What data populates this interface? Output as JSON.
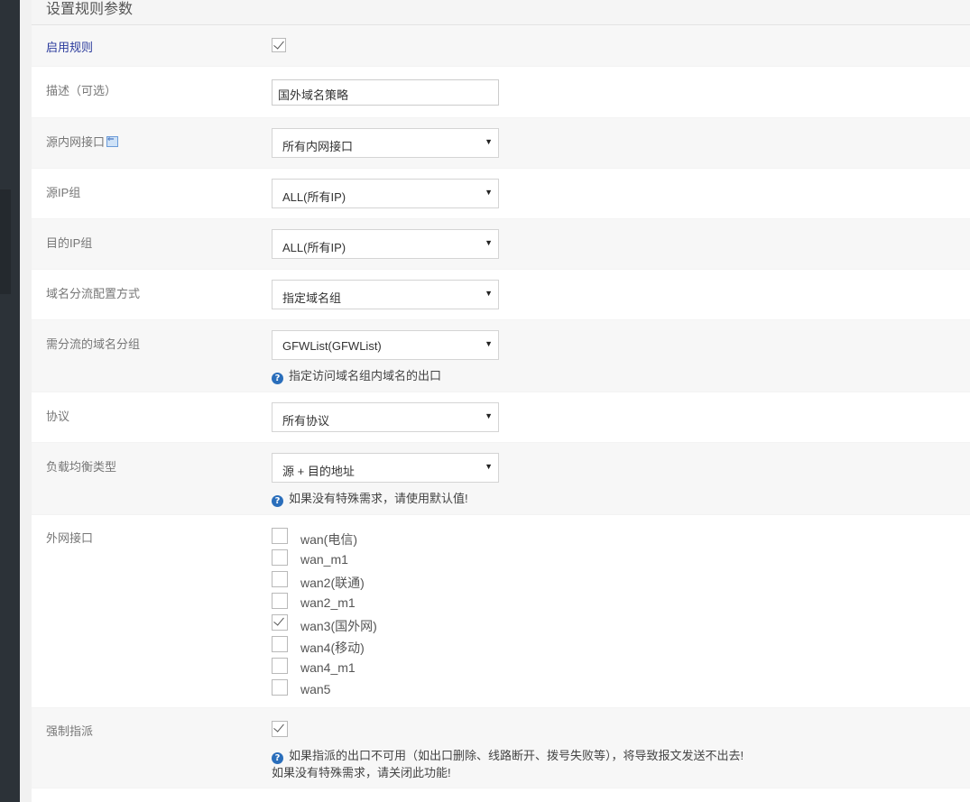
{
  "section_title": "设置规则参数",
  "rows": {
    "enable": {
      "label": "启用规则",
      "checked": true
    },
    "description": {
      "label": "描述（可选）",
      "value": "国外域名策略"
    },
    "src_iface": {
      "label": "源内网接口",
      "value": "所有内网接口",
      "icon": "back-arrow-icon"
    },
    "src_ip": {
      "label": "源IP组",
      "value": "ALL(所有IP)"
    },
    "dst_ip": {
      "label": "目的IP组",
      "value": "ALL(所有IP)"
    },
    "domain_mode": {
      "label": "域名分流配置方式",
      "value": "指定域名组"
    },
    "domain_group": {
      "label": "需分流的域名分组",
      "value": "GFWList(GFWList)",
      "hint": "指定访问域名组内域名的出口"
    },
    "protocol": {
      "label": "协议",
      "value": "所有协议"
    },
    "lb_type": {
      "label": "负载均衡类型",
      "value": "源 + 目的地址",
      "hint": "如果没有特殊需求，请使用默认值!"
    },
    "wan": {
      "label": "外网接口",
      "items": [
        {
          "name": "wan(电信)",
          "checked": false
        },
        {
          "name": "wan_m1",
          "checked": false
        },
        {
          "name": "wan2(联通)",
          "checked": false
        },
        {
          "name": "wan2_m1",
          "checked": false
        },
        {
          "name": "wan3(国外网)",
          "checked": true
        },
        {
          "name": "wan4(移动)",
          "checked": false
        },
        {
          "name": "wan4_m1",
          "checked": false
        },
        {
          "name": "wan5",
          "checked": false
        }
      ]
    },
    "force": {
      "label": "强制指派",
      "checked": true,
      "hint1": "如果指派的出口不可用（如出口删除、线路断开、拨号失败等），将导致报文发送不出去!",
      "hint2": "如果没有特殊需求，请关闭此功能!"
    }
  },
  "colors": {
    "label_blue": "#2a3a9c",
    "help_icon": "#2a6ebb",
    "sidebar": "#2c3238"
  }
}
